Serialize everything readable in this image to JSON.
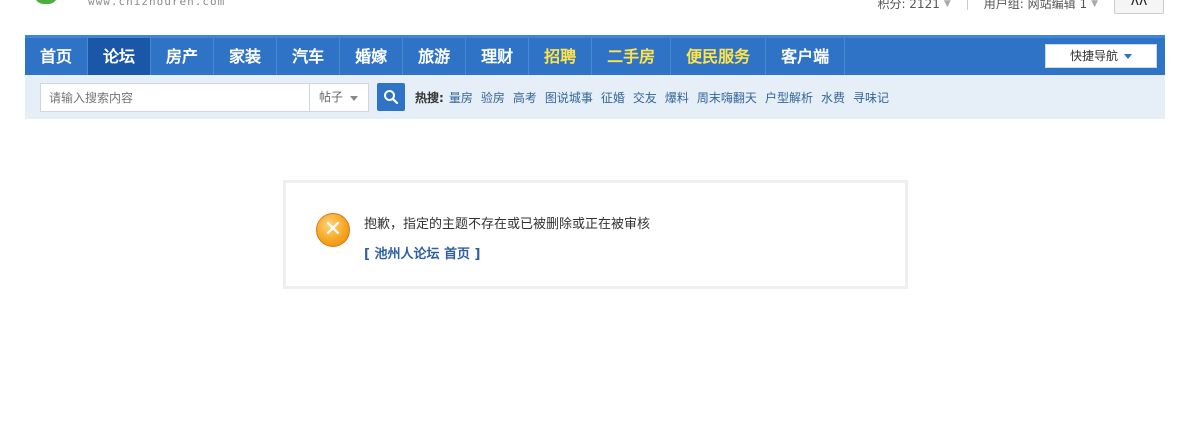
{
  "header": {
    "site_url": "www.chizhouren.com",
    "points_text": "积分: 2121",
    "usergroup_text": "用户组: 网站编辑 1",
    "avatar_text": "ʌʌ"
  },
  "nav": {
    "items": [
      {
        "label": "首页",
        "active": false,
        "highlight": false
      },
      {
        "label": "论坛",
        "active": true,
        "highlight": false
      },
      {
        "label": "房产",
        "active": false,
        "highlight": false
      },
      {
        "label": "家装",
        "active": false,
        "highlight": false
      },
      {
        "label": "汽车",
        "active": false,
        "highlight": false
      },
      {
        "label": "婚嫁",
        "active": false,
        "highlight": false
      },
      {
        "label": "旅游",
        "active": false,
        "highlight": false
      },
      {
        "label": "理财",
        "active": false,
        "highlight": false
      },
      {
        "label": "招聘",
        "active": false,
        "highlight": true
      },
      {
        "label": "二手房",
        "active": false,
        "highlight": true
      },
      {
        "label": "便民服务",
        "active": false,
        "highlight": true
      },
      {
        "label": "客户端",
        "active": false,
        "highlight": false
      }
    ],
    "quick_nav_label": "快捷导航"
  },
  "search": {
    "placeholder": "请输入搜索内容",
    "type_selected": "帖子",
    "hot_label": "热搜:",
    "hot_items": [
      "量房",
      "验房",
      "高考",
      "图说城事",
      "征婚",
      "交友",
      "爆料",
      "周末嗨翻天",
      "户型解析",
      "水费",
      "寻味记"
    ]
  },
  "message": {
    "text": "抱歉，指定的主题不存在或已被删除或正在被审核",
    "link_label": "[ 池州人论坛 首页 ]"
  },
  "colors": {
    "nav_bg": "#2f73c6",
    "nav_active": "#1a57a8",
    "highlight": "#ffe44a",
    "search_bg": "#e6eef7",
    "link": "#2f5fa0"
  }
}
